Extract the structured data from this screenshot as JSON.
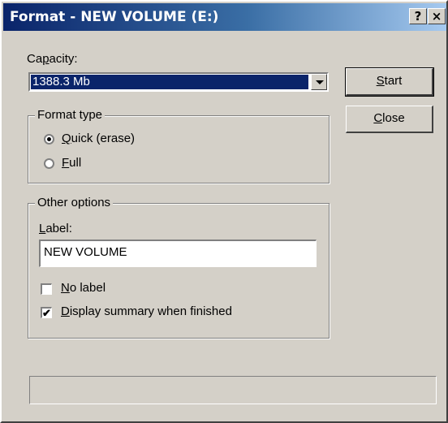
{
  "window": {
    "title": "Format - NEW VOLUME (E:)",
    "help_button": "?",
    "close_button": "×"
  },
  "capacity": {
    "label_pre": "Ca",
    "label_accel": "p",
    "label_post": "acity:",
    "selected": "1388.3 Mb"
  },
  "buttons": {
    "start_accel": "S",
    "start_rest": "tart",
    "close_accel": "C",
    "close_rest": "lose"
  },
  "format_type": {
    "legend": "Format type",
    "quick_accel": "Q",
    "quick_rest": "uick (erase)",
    "full_accel": "F",
    "full_rest": "ull",
    "selected": "Quick (erase)"
  },
  "other_options": {
    "legend": "Other options",
    "label_accel": "L",
    "label_rest": "abel:",
    "label_value": "NEW VOLUME",
    "no_label_accel": "N",
    "no_label_rest": "o label",
    "no_label_checked": false,
    "display_summary_accel": "D",
    "display_summary_rest": "isplay summary when finished",
    "display_summary_checked": true,
    "check_glyph": "✔"
  },
  "status": {
    "text": ""
  }
}
